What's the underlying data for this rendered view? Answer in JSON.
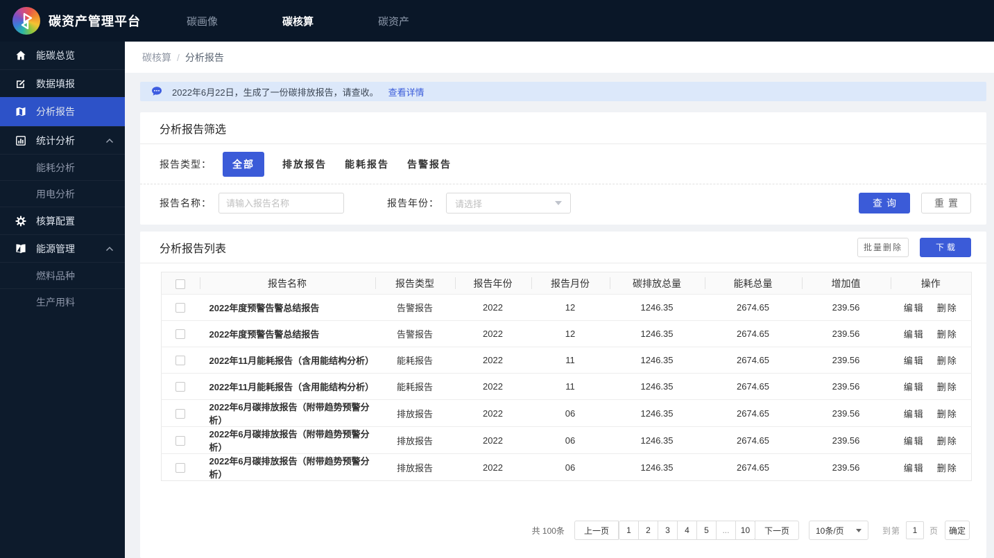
{
  "colors": {
    "accent": "#3b5bd8",
    "sidebar_active": "#2d52c8",
    "topbar_bg": "#0a1728",
    "sidebar_bg": "#0d1b2c",
    "notice_bg": "#dce8fa",
    "link": "#3a5bd9",
    "page_bg": "#f0f2f5"
  },
  "topbar": {
    "brand": "碳资产管理平台",
    "nav": [
      {
        "label": "碳画像",
        "active": false
      },
      {
        "label": "碳核算",
        "active": true
      },
      {
        "label": "碳资产",
        "active": false
      }
    ]
  },
  "sidebar": {
    "items": [
      {
        "label": "能碳总览",
        "icon": "home",
        "active": false
      },
      {
        "label": "数据填报",
        "icon": "edit",
        "active": false
      },
      {
        "label": "分析报告",
        "icon": "report",
        "active": true
      },
      {
        "label": "统计分析",
        "icon": "chart",
        "active": false,
        "expanded": true,
        "children": [
          "能耗分析",
          "用电分析"
        ]
      },
      {
        "label": "核算配置",
        "icon": "gear",
        "active": false
      },
      {
        "label": "能源管理",
        "icon": "book",
        "active": false,
        "expanded": true,
        "children": [
          "燃料品种",
          "生产用料"
        ]
      }
    ]
  },
  "breadcrumb": {
    "parent": "碳核算",
    "separator": "/",
    "current": "分析报告"
  },
  "notice": {
    "icon": "chat-bubble-icon",
    "text": "2022年6月22日，生成了一份碳排放报告，请查收。",
    "link": "查看详情"
  },
  "filter": {
    "title": "分析报告筛选",
    "type_label": "报告类型：",
    "types": [
      "全部",
      "排放报告",
      "能耗报告",
      "告警报告"
    ],
    "active_type": "全部",
    "name_label": "报告名称：",
    "name_placeholder": "请输入报告名称",
    "year_label": "报告年份：",
    "year_placeholder": "请选择",
    "search_btn": "查询",
    "reset_btn": "重置"
  },
  "list": {
    "title": "分析报告列表",
    "batch_delete_btn": "批量删除",
    "download_btn": "下载",
    "columns": [
      "报告名称",
      "报告类型",
      "报告年份",
      "报告月份",
      "碳排放总量",
      "能耗总量",
      "增加值",
      "操作"
    ],
    "edit_label": "编辑",
    "delete_label": "删除",
    "rows": [
      {
        "name": "2022年度预警告警总结报告",
        "type": "告警报告",
        "year": "2022",
        "month": "12",
        "carbon": "1246.35",
        "energy": "2674.65",
        "added": "239.56"
      },
      {
        "name": "2022年度预警告警总结报告",
        "type": "告警报告",
        "year": "2022",
        "month": "12",
        "carbon": "1246.35",
        "energy": "2674.65",
        "added": "239.56"
      },
      {
        "name": "2022年11月能耗报告（含用能结构分析）",
        "type": "能耗报告",
        "year": "2022",
        "month": "11",
        "carbon": "1246.35",
        "energy": "2674.65",
        "added": "239.56"
      },
      {
        "name": "2022年11月能耗报告（含用能结构分析）",
        "type": "能耗报告",
        "year": "2022",
        "month": "11",
        "carbon": "1246.35",
        "energy": "2674.65",
        "added": "239.56"
      },
      {
        "name": "2022年6月碳排放报告（附带趋势预警分析）",
        "type": "排放报告",
        "year": "2022",
        "month": "06",
        "carbon": "1246.35",
        "energy": "2674.65",
        "added": "239.56"
      },
      {
        "name": "2022年6月碳排放报告（附带趋势预警分析）",
        "type": "排放报告",
        "year": "2022",
        "month": "06",
        "carbon": "1246.35",
        "energy": "2674.65",
        "added": "239.56"
      },
      {
        "name": "2022年6月碳排放报告（附带趋势预警分析）",
        "type": "排放报告",
        "year": "2022",
        "month": "06",
        "carbon": "1246.35",
        "energy": "2674.65",
        "added": "239.56"
      }
    ]
  },
  "pagination": {
    "total": "共 100条",
    "prev": "上一页",
    "pages": [
      "1",
      "2",
      "3",
      "4",
      "5",
      "...",
      "10"
    ],
    "next": "下一页",
    "page_size": "10条/页",
    "goto_label": "到第",
    "goto_value": "1",
    "page_unit": "页",
    "confirm_btn": "确定"
  }
}
